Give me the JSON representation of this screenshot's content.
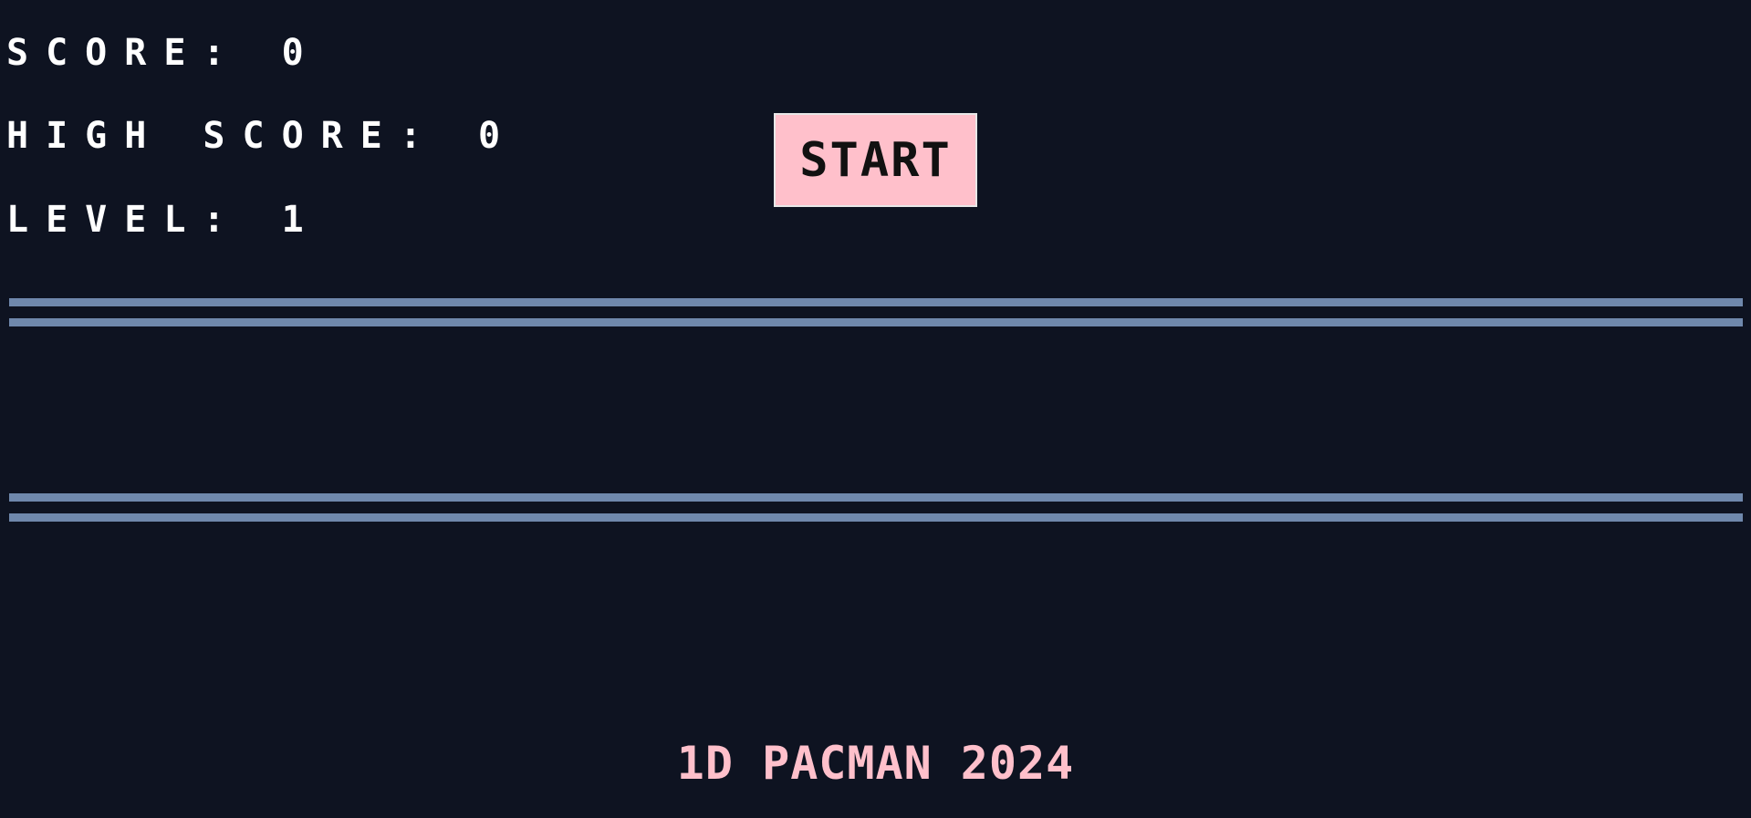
{
  "hud": {
    "score_label": "SCORE:",
    "score_value": "0",
    "high_score_label": "HIGH SCORE:",
    "high_score_value": "0",
    "level_label": "LEVEL:",
    "level_value": "1"
  },
  "controls": {
    "start_label": "START"
  },
  "footer": {
    "title": "1D PACMAN 2024"
  },
  "colors": {
    "background": "#0e1321",
    "hud_text": "#ffffff",
    "accent_pink": "#ffc0cb",
    "track_line": "#6f88ac"
  }
}
